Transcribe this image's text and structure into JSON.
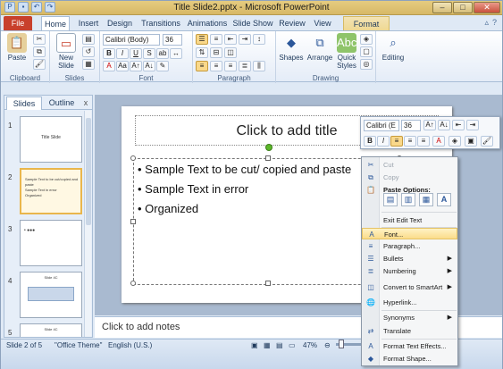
{
  "window": {
    "title": "Title Slide2.pptx - Microsoft PowerPoint",
    "controls": [
      "–",
      "□",
      "✕"
    ]
  },
  "ribbon_tabs": [
    {
      "label": "File"
    },
    {
      "label": "Home"
    },
    {
      "label": "Insert"
    },
    {
      "label": "Design"
    },
    {
      "label": "Transitions"
    },
    {
      "label": "Animations"
    },
    {
      "label": "Slide Show"
    },
    {
      "label": "Review"
    },
    {
      "label": "View"
    },
    {
      "label": "Format"
    }
  ],
  "ribbon": {
    "clipboard": {
      "paste_label": "Paste",
      "group_label": "Clipboard"
    },
    "slides": {
      "new_slide_label": "New Slide",
      "group_label": "Slides"
    },
    "font": {
      "font_name": "Calibri (Body)",
      "font_size": "36",
      "group_label": "Font"
    },
    "paragraph": {
      "group_label": "Paragraph"
    },
    "drawing": {
      "shapes_label": "Shapes",
      "arrange_label": "Arrange",
      "quick_styles_label": "Quick Styles",
      "group_label": "Drawing"
    },
    "editing": {
      "editing_label": "Editing"
    }
  },
  "side_panel": {
    "tabs": {
      "slides": "Slides",
      "outline": "Outline",
      "close": "x"
    },
    "thumbnails": [
      {
        "number": "1",
        "text": "Title Slide"
      },
      {
        "number": "2",
        "text": "Sample Text to be cut/copied and paste\nSample Text in error\nOrganized"
      },
      {
        "number": "3",
        "text": "• ●●●"
      },
      {
        "number": "4",
        "text": "Slide 4C"
      },
      {
        "number": "5",
        "text": "Slide 4C"
      }
    ]
  },
  "slide": {
    "title_placeholder": "Click to add title",
    "bullets": [
      "Sample Text to be cut/ copied and paste",
      "Sample Text in error",
      "Organized"
    ]
  },
  "notes": {
    "placeholder": "Click to add notes"
  },
  "mini_toolbar": {
    "font_name": "Calibri (E",
    "font_size": "36"
  },
  "context_menu": {
    "cut": "Cut",
    "copy": "Copy",
    "paste_options": "Paste Options:",
    "exit_edit_text": "Exit Edit Text",
    "font": "Font...",
    "paragraph": "Paragraph...",
    "bullets": "Bullets",
    "numbering": "Numbering",
    "convert_to_smartart": "Convert to SmartArt",
    "hyperlink": "Hyperlink...",
    "synonyms": "Synonyms",
    "translate": "Translate",
    "format_text_effects": "Format Text Effects...",
    "format_shape": "Format Shape..."
  },
  "status_bar": {
    "slide_position": "Slide 2 of 5",
    "theme": "\"Office Theme\"",
    "language": "English (U.S.)",
    "zoom": "47%"
  }
}
